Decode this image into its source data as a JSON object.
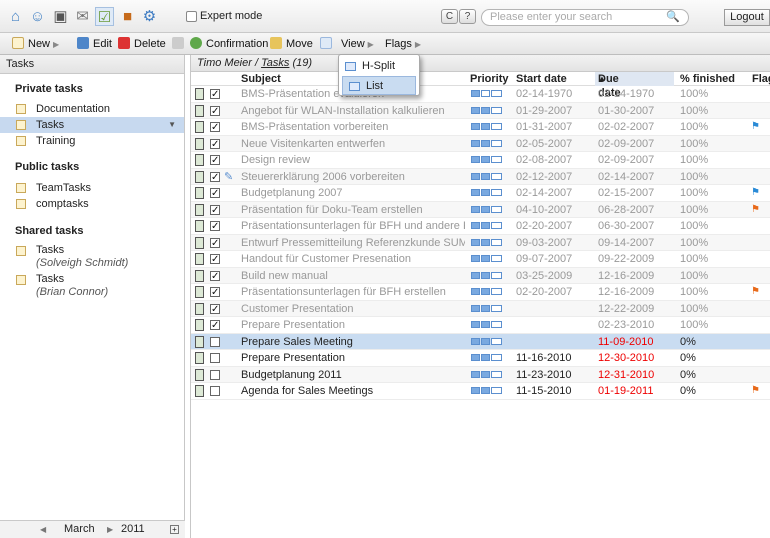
{
  "topbar": {
    "expert_label": "Expert mode",
    "help_btn1": "C",
    "help_btn2": "?",
    "search_placeholder": "Please enter your search",
    "logout": "Logout"
  },
  "toolbar": {
    "new": "New",
    "edit": "Edit",
    "delete": "Delete",
    "confirmation": "Confirmation",
    "move": "Move",
    "view": "View",
    "flags": "Flags"
  },
  "view_menu": {
    "items": [
      "H-Split",
      "List"
    ]
  },
  "sidebar": {
    "title": "Tasks",
    "private_title": "Private tasks",
    "private": [
      "Documentation",
      "Tasks",
      "Training"
    ],
    "public_title": "Public tasks",
    "public": [
      "TeamTasks",
      "comptasks"
    ],
    "shared_title": "Shared tasks",
    "shared": [
      {
        "name": "Tasks",
        "owner": "(Solveigh Schmidt)"
      },
      {
        "name": "Tasks",
        "owner": "(Brian Connor)"
      }
    ],
    "footer_month": "March",
    "footer_year": "2011"
  },
  "main": {
    "crumb_user": "Timo Meier",
    "crumb_folder": "Tasks",
    "crumb_count": "(19)",
    "columns": [
      "Subject",
      "Priority",
      "Start date",
      "Due date",
      "% finished",
      "Flag"
    ]
  },
  "rows": [
    {
      "subject": "BMS-Präsentation evaluieren",
      "start": "02-14-1970",
      "due": "02-14-1970",
      "pct": "100%",
      "done": true,
      "prio": 1,
      "flag": ""
    },
    {
      "subject": "Angebot für WLAN-Installation kalkulieren",
      "start": "01-29-2007",
      "due": "01-30-2007",
      "pct": "100%",
      "done": true,
      "prio": 2,
      "flag": ""
    },
    {
      "subject": "BMS-Präsentation vorbereiten",
      "start": "01-31-2007",
      "due": "02-02-2007",
      "pct": "100%",
      "done": true,
      "prio": 2,
      "flag": "blue"
    },
    {
      "subject": "Neue Visitenkarten entwerfen",
      "start": "02-05-2007",
      "due": "02-09-2007",
      "pct": "100%",
      "done": true,
      "prio": 2,
      "flag": ""
    },
    {
      "subject": "Design review",
      "start": "02-08-2007",
      "due": "02-09-2007",
      "pct": "100%",
      "done": true,
      "prio": 2,
      "flag": ""
    },
    {
      "subject": "Steuererklärung 2006 vorbereiten",
      "start": "02-12-2007",
      "due": "02-14-2007",
      "pct": "100%",
      "done": true,
      "prio": 2,
      "flag": ""
    },
    {
      "subject": "Budgetplanung 2007",
      "start": "02-14-2007",
      "due": "02-15-2007",
      "pct": "100%",
      "done": true,
      "prio": 2,
      "flag": "blue"
    },
    {
      "subject": "Präsentation für Doku-Team erstellen",
      "start": "04-10-2007",
      "due": "06-28-2007",
      "pct": "100%",
      "done": true,
      "prio": 2,
      "flag": "orange"
    },
    {
      "subject": "Präsentationsunterlagen für BFH und andere Kunden",
      "start": "02-20-2007",
      "due": "06-30-2007",
      "pct": "100%",
      "done": true,
      "prio": 2,
      "flag": ""
    },
    {
      "subject": "Entwurf Pressemitteilung Referenzkunde SUMAG",
      "start": "09-03-2007",
      "due": "09-14-2007",
      "pct": "100%",
      "done": true,
      "prio": 2,
      "flag": ""
    },
    {
      "subject": "Handout für Customer Presenation",
      "start": "09-07-2007",
      "due": "09-22-2009",
      "pct": "100%",
      "done": true,
      "prio": 2,
      "flag": ""
    },
    {
      "subject": "Build new manual",
      "start": "03-25-2009",
      "due": "12-16-2009",
      "pct": "100%",
      "done": true,
      "prio": 2,
      "flag": ""
    },
    {
      "subject": "Präsentationsunterlagen für BFH erstellen",
      "start": "02-20-2007",
      "due": "12-16-2009",
      "pct": "100%",
      "done": true,
      "prio": 2,
      "flag": "orange"
    },
    {
      "subject": "Customer Presentation",
      "start": "",
      "due": "12-22-2009",
      "pct": "100%",
      "done": true,
      "prio": 2,
      "flag": ""
    },
    {
      "subject": "Prepare Presentation",
      "start": "",
      "due": "02-23-2010",
      "pct": "100%",
      "done": true,
      "prio": 2,
      "flag": ""
    },
    {
      "subject": "Prepare Sales Meeting",
      "start": "",
      "due": "11-09-2010",
      "pct": "0%",
      "done": false,
      "prio": 2,
      "flag": "",
      "overdue": true
    },
    {
      "subject": "Prepare Presentation",
      "start": "11-16-2010",
      "due": "12-30-2010",
      "pct": "0%",
      "done": false,
      "prio": 2,
      "flag": "",
      "overdue": true
    },
    {
      "subject": "Budgetplanung 2011",
      "start": "11-23-2010",
      "due": "12-31-2010",
      "pct": "0%",
      "done": false,
      "prio": 2,
      "flag": "",
      "overdue": true
    },
    {
      "subject": "Agenda for Sales Meetings",
      "start": "11-15-2010",
      "due": "01-19-2011",
      "pct": "0%",
      "done": false,
      "prio": 2,
      "flag": "orange",
      "overdue": true
    }
  ]
}
